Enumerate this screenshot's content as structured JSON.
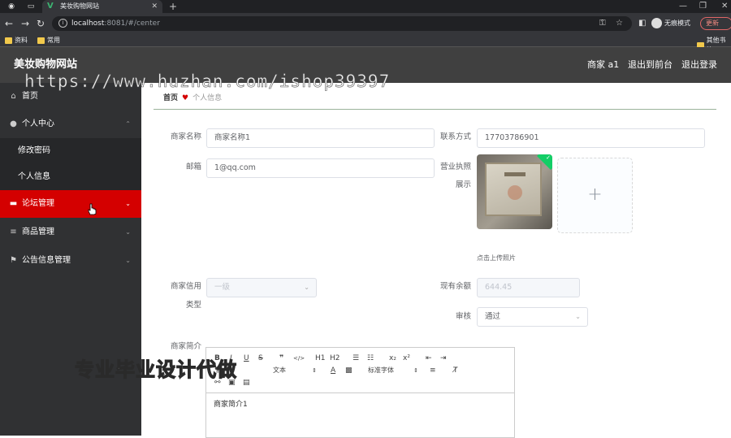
{
  "browser": {
    "tab_title": "美妆购物网站",
    "url_host": "localhost",
    "url_path": ":8081/#/center",
    "profile_label": "无痕模式",
    "update_label": "更新",
    "bookmarks": [
      "资料",
      "常用"
    ],
    "bookmark_right": "其他书签"
  },
  "header": {
    "title": "美妆购物网站",
    "user_label": "商家 a1",
    "back_label": "退出到前台",
    "logout_label": "退出登录"
  },
  "watermark": "https://www.huzhan.com/ishop39397",
  "sidebar": {
    "items": [
      {
        "label": "首页",
        "icon": "home-icon"
      },
      {
        "label": "个人中心",
        "icon": "user-icon"
      },
      {
        "label": "修改密码"
      },
      {
        "label": "个人信息"
      },
      {
        "label": "论坛管理",
        "icon": "forum-icon"
      },
      {
        "label": "商品管理",
        "icon": "list-icon"
      },
      {
        "label": "公告信息管理",
        "icon": "flag-icon"
      }
    ]
  },
  "breadcrumb": {
    "home": "首页",
    "current": "个人信息"
  },
  "form": {
    "merchant_name_label": "商家名称",
    "merchant_name_value": "商家名称1",
    "contact_label": "联系方式",
    "contact_value": "17703786901",
    "email_label": "邮箱",
    "email_value": "1@qq.com",
    "license_label_1": "营业执照",
    "license_label_2": "展示",
    "upload_tip": "点击上传照片",
    "credit_label_1": "商家信用",
    "credit_label_2": "类型",
    "credit_value": "一级",
    "balance_label": "现有余额",
    "balance_value": "644.45",
    "review_label": "审核",
    "review_value": "通过",
    "intro_label": "商家简介"
  },
  "editor": {
    "buttons": [
      "B",
      "I",
      "U",
      "S",
      "❞",
      "</>",
      "H1",
      "H2",
      "ol",
      "ul",
      "x₂",
      "x²",
      "outdent",
      "indent"
    ],
    "font_size_select": "文本",
    "font_family_select": "标准字体",
    "content": "商家简介1"
  },
  "overlay_text": "专业毕业设计代做",
  "colors": {
    "header_bg": "#404040",
    "sidebar_bg": "#303133",
    "active_bg": "#d40000"
  }
}
